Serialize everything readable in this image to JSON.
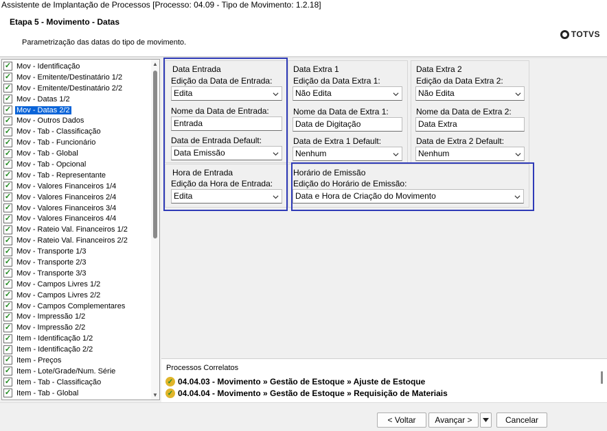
{
  "window": {
    "title": "Assistente de Implantação de Processos [Processo: 04.09 - Tipo de Movimento: 1.2.18]"
  },
  "header": {
    "step_title": "Etapa 5 - Movimento - Datas",
    "step_description": "Parametrização das datas do tipo de movimento.",
    "logo_text": "TOTVS"
  },
  "tree": {
    "selected_index": 4,
    "items": [
      "Mov - Identificação",
      "Mov - Emitente/Destinatário 1/2",
      "Mov - Emitente/Destinatário 2/2",
      "Mov - Datas 1/2",
      "Mov - Datas 2/2",
      "Mov - Outros Dados",
      "Mov - Tab - Classificação",
      "Mov - Tab - Funcionário",
      "Mov - Tab - Global",
      "Mov - Tab - Opcional",
      "Mov - Tab - Representante",
      "Mov - Valores Financeiros 1/4",
      "Mov - Valores Financeiros 2/4",
      "Mov - Valores Financeiros 3/4",
      "Mov - Valores Financeiros 4/4",
      "Mov - Rateio Val. Financeiros 1/2",
      "Mov - Rateio Val. Financeiros 2/2",
      "Mov - Transporte 1/3",
      "Mov - Transporte 2/3",
      "Mov - Transporte 3/3",
      "Mov - Campos Livres 1/2",
      "Mov - Campos Livres 2/2",
      "Mov - Campos Complementares",
      "Mov - Impressão 1/2",
      "Mov - Impressão 2/2",
      "Item - Identificação 1/2",
      "Item - Identificação 2/2",
      "Item - Preços",
      "Item - Lote/Grade/Num. Série",
      "Item - Tab - Classificação",
      "Item - Tab - Global"
    ]
  },
  "data_entrada": {
    "group_title": "Data Entrada",
    "edicao_label": "Edição da Data de Entrada:",
    "edicao_value": "Edita",
    "nome_label": "Nome da Data de Entrada:",
    "nome_value": "Entrada",
    "default_label": "Data de Entrada Default:",
    "default_value": "Data Emissão"
  },
  "data_extra1": {
    "group_title": "Data Extra 1",
    "edicao_label": "Edição da Data Extra 1:",
    "edicao_value": "Não Edita",
    "nome_label": "Nome da Data de Extra 1:",
    "nome_value": "Data de Digitação",
    "default_label": "Data de Extra 1 Default:",
    "default_value": "Nenhum"
  },
  "data_extra2": {
    "group_title": "Data Extra 2",
    "edicao_label": "Edição da Data Extra 2:",
    "edicao_value": "Não Edita",
    "nome_label": "Nome da Data de Extra 2:",
    "nome_value": "Data Extra",
    "default_label": "Data de Extra 2 Default:",
    "default_value": "Nenhum"
  },
  "hora_entrada": {
    "group_title": "Hora de Entrada",
    "edicao_label": "Edição da Hora de Entrada:",
    "edicao_value": "Edita"
  },
  "horario_emissao": {
    "group_title": "Horário de Emissão",
    "edicao_label": "Edição do Horário de Emissão:",
    "edicao_value": "Data e Hora de Criação do Movimento"
  },
  "related": {
    "title": "Processos Correlatos",
    "items": [
      "04.04.03 - Movimento » Gestão de Estoque » Ajuste de Estoque",
      "04.04.04 - Movimento » Gestão de Estoque » Requisição de Materiais"
    ]
  },
  "footer": {
    "back_label": "< Voltar",
    "next_label": "Avançar >",
    "cancel_label": "Cancelar"
  },
  "colors": {
    "selection": "#0a64d8",
    "highlight_border": "#2e3ab7",
    "check": "#1f8a1f"
  }
}
